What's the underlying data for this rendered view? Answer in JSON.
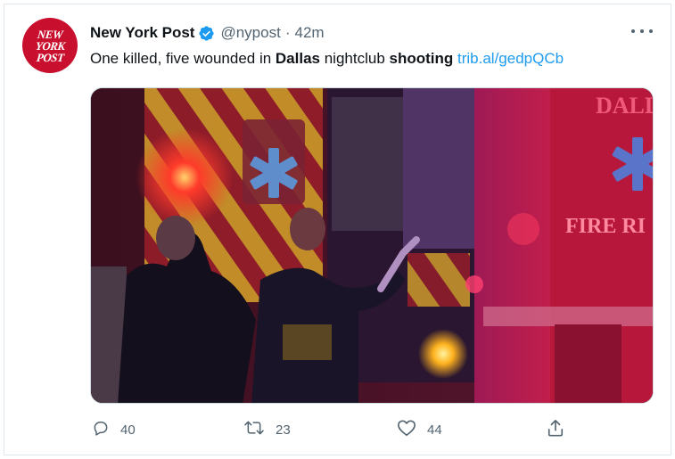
{
  "tweet": {
    "author_name": "New York Post",
    "handle": "@nypost",
    "separator": "·",
    "time": "42m",
    "avatar": {
      "line1": "NEW",
      "line2": "YORK",
      "line3": "POST",
      "color": "#c8102e"
    },
    "text": {
      "part1": "One killed, five wounded in ",
      "bold1": "Dallas",
      "part2": " nightclub ",
      "bold2": "shooting",
      "link": "trib.al/gedpQCb"
    },
    "media": {
      "truck_text_top": "DALL",
      "truck_text_side": "FIRE RI"
    },
    "stats": {
      "replies": "40",
      "retweets": "23",
      "likes": "44"
    },
    "icons": {
      "verified": "verified-badge-icon",
      "more": "more-options-icon",
      "reply": "reply-icon",
      "retweet": "retweet-icon",
      "like": "heart-icon",
      "share": "share-icon"
    },
    "colors": {
      "link": "#1d9bf0",
      "verified": "#1d9bf0",
      "secondary_text": "#536471"
    }
  }
}
